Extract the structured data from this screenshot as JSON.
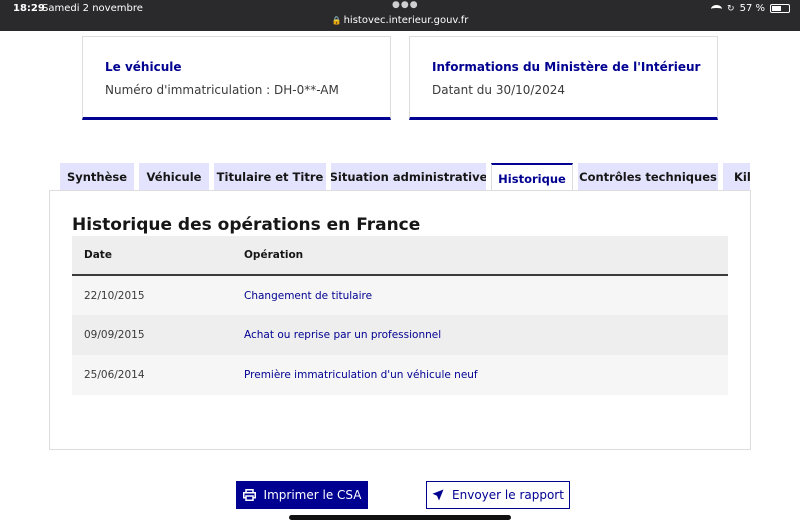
{
  "status_bar": {
    "time": "18:29",
    "date": "Samedi 2 novembre",
    "url": "histovec.interieur.gouv.fr",
    "battery": "57 %",
    "battery_level": 0.57
  },
  "cards": [
    {
      "title": "Le véhicule",
      "text": "Numéro d'immatriculation : DH-0**-AM"
    },
    {
      "title": "Informations du Ministère de l'Intérieur",
      "text": "Datant du 30/10/2024"
    }
  ],
  "tabs": [
    {
      "label": "Synthèse",
      "active": false
    },
    {
      "label": "Véhicule",
      "active": false
    },
    {
      "label": "Titulaire et Titre",
      "active": false
    },
    {
      "label": "Situation administrative",
      "active": false
    },
    {
      "label": "Historique",
      "active": true
    },
    {
      "label": "Contrôles techniques",
      "active": false
    },
    {
      "label": "Kilo",
      "active": false
    }
  ],
  "history": {
    "title": "Historique des opérations en France",
    "columns": [
      "Date",
      "Opération"
    ],
    "rows": [
      {
        "date": "22/10/2015",
        "operation": "Changement de titulaire"
      },
      {
        "date": "09/09/2015",
        "operation": "Achat ou reprise par un professionnel"
      },
      {
        "date": "25/06/2014",
        "operation": "Première immatriculation d'un véhicule neuf"
      }
    ]
  },
  "actions": {
    "print_label": "Imprimer le CSA",
    "send_label": "Envoyer le rapport"
  },
  "colors": {
    "primary": "#000091",
    "tab_background": "#e3e3fd",
    "status_bar": "#2a2a2c"
  }
}
